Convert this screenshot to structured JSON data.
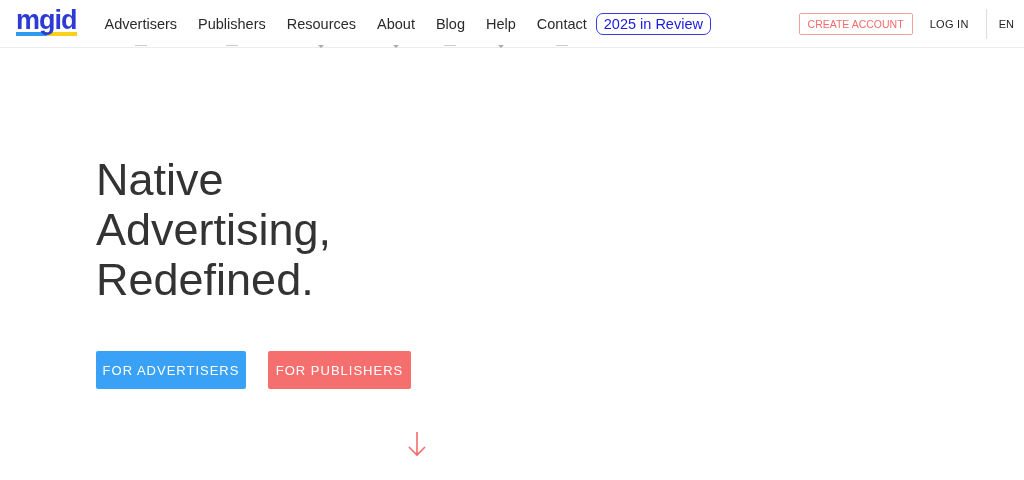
{
  "header": {
    "logo": "mgid",
    "nav": [
      {
        "label": "Advertisers",
        "kind": "link"
      },
      {
        "label": "Publishers",
        "kind": "link"
      },
      {
        "label": "Resources",
        "kind": "dropdown"
      },
      {
        "label": "About",
        "kind": "dropdown"
      },
      {
        "label": "Blog",
        "kind": "link"
      },
      {
        "label": "Help",
        "kind": "dropdown"
      },
      {
        "label": "Contact",
        "kind": "link"
      },
      {
        "label": "2025 in Review",
        "kind": "highlight"
      }
    ],
    "create_account": "CREATE ACCOUNT",
    "login": "LOG IN",
    "language": "EN"
  },
  "hero": {
    "title": [
      "Native",
      "Advertising,",
      "Redefined."
    ],
    "buttons": [
      {
        "label": "FOR ADVERTISERS",
        "kind": "primary"
      },
      {
        "label": "FOR PUBLISHERS",
        "kind": "secondary"
      }
    ]
  }
}
